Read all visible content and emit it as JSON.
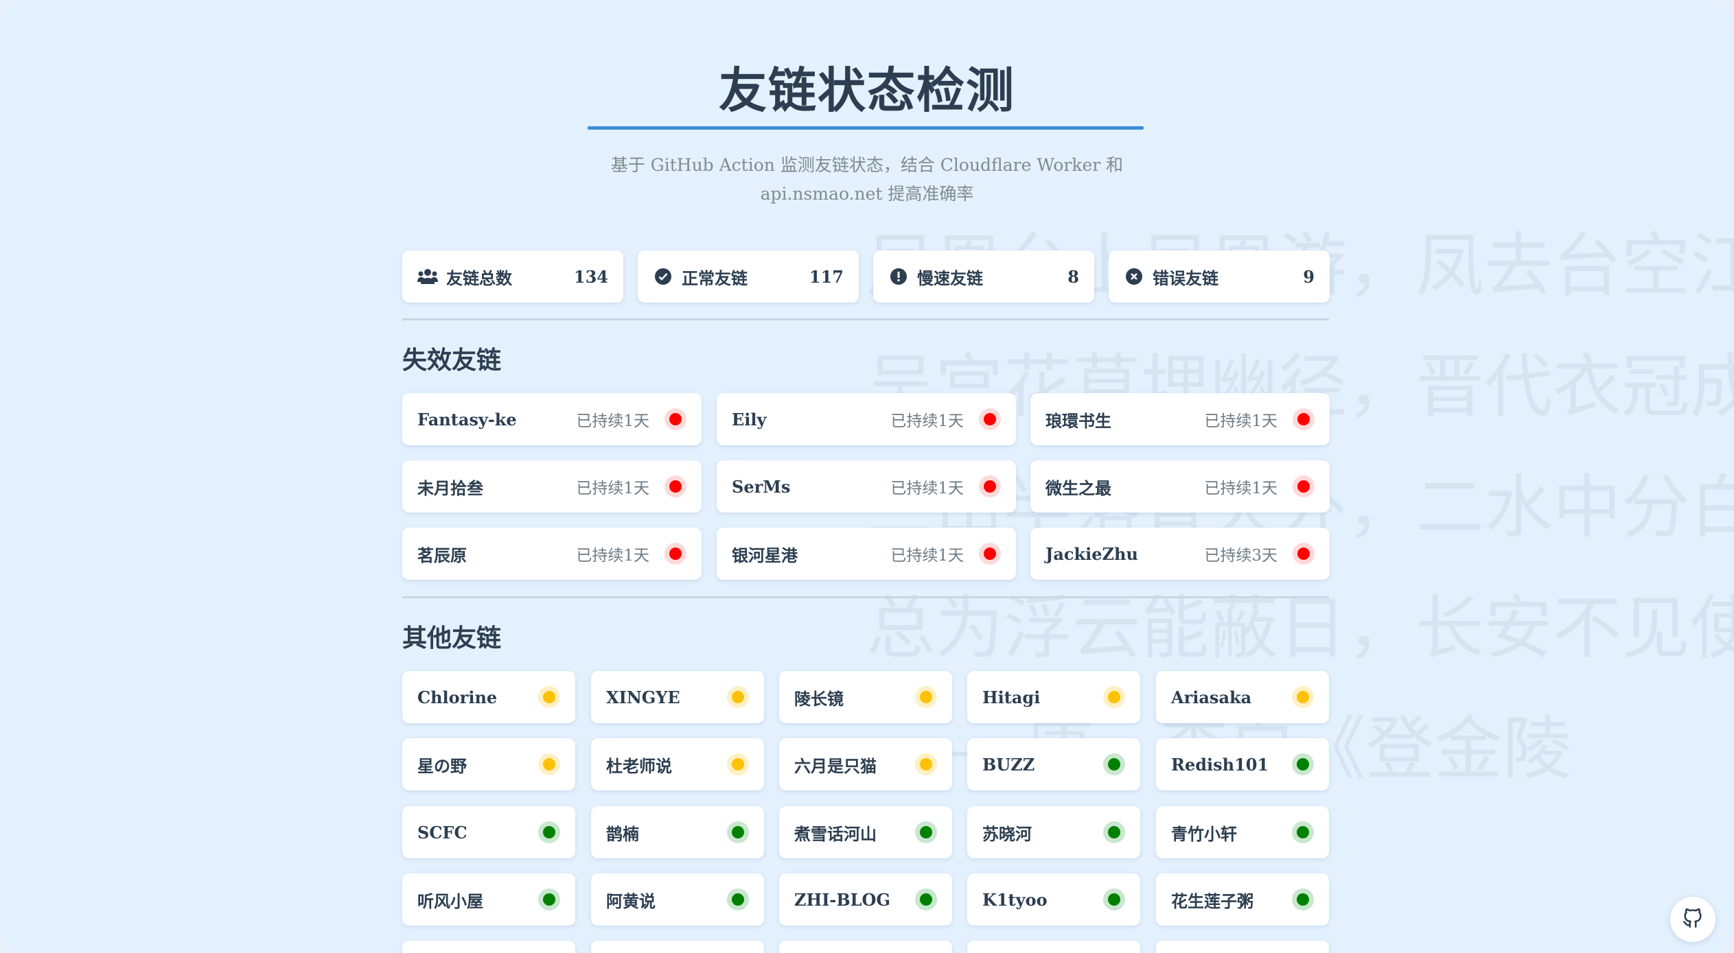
{
  "title": "友链状态检测",
  "subtitle_line1": "基于 GitHub Action 监测友链状态，结合 Cloudflare Worker 和",
  "subtitle_line2": "api.nsmao.net 提高准确率",
  "background_poem": [
    "凤凰台上凤凰游，凤去台空江",
    "吴宫花草埋幽径，晋代衣冠成",
    "三山半落青天外，二水中分白",
    "总为浮云能蔽日，长安不见使",
    "—— 唐 · 李白《登金陵"
  ],
  "stats": [
    {
      "label": "友链总数",
      "value": "134",
      "icon": "users-icon"
    },
    {
      "label": "正常友链",
      "value": "117",
      "icon": "check-circle-icon"
    },
    {
      "label": "慢速友链",
      "value": "8",
      "icon": "exclamation-circle-icon"
    },
    {
      "label": "错误友链",
      "value": "9",
      "icon": "x-circle-icon"
    }
  ],
  "failed_section": {
    "title": "失效友链",
    "items": [
      {
        "name": "Fantasy-ke",
        "duration": "已持续1天"
      },
      {
        "name": "Eily",
        "duration": "已持续1天"
      },
      {
        "name": "琅環书生",
        "duration": "已持续1天"
      },
      {
        "name": "未月拾叁",
        "duration": "已持续1天"
      },
      {
        "name": "SerMs",
        "duration": "已持续1天"
      },
      {
        "name": "微生之最",
        "duration": "已持续1天"
      },
      {
        "name": "茗辰原",
        "duration": "已持续1天"
      },
      {
        "name": "银河星港",
        "duration": "已持续1天"
      },
      {
        "name": "JackieZhu",
        "duration": "已持续3天"
      }
    ]
  },
  "other_section": {
    "title": "其他友链",
    "items": [
      {
        "name": "Chlorine",
        "status": "slow"
      },
      {
        "name": "XINGYE",
        "status": "slow"
      },
      {
        "name": "陵长镜",
        "status": "slow"
      },
      {
        "name": "Hitagi",
        "status": "slow"
      },
      {
        "name": "Ariasaka",
        "status": "slow"
      },
      {
        "name": "星の野",
        "status": "slow"
      },
      {
        "name": "杜老师说",
        "status": "slow"
      },
      {
        "name": "六月是只猫",
        "status": "slow"
      },
      {
        "name": "BUZZ",
        "status": "ok"
      },
      {
        "name": "Redish101",
        "status": "ok"
      },
      {
        "name": "SCFC",
        "status": "ok"
      },
      {
        "name": "鹊楠",
        "status": "ok"
      },
      {
        "name": "煮雪话河山",
        "status": "ok"
      },
      {
        "name": "苏晓河",
        "status": "ok"
      },
      {
        "name": "青竹小轩",
        "status": "ok"
      },
      {
        "name": "听风小屋",
        "status": "ok"
      },
      {
        "name": "阿黄说",
        "status": "ok"
      },
      {
        "name": "ZHI-BLOG",
        "status": "ok"
      },
      {
        "name": "K1tyoo",
        "status": "ok"
      },
      {
        "name": "花生莲子粥",
        "status": "ok"
      }
    ]
  },
  "colors": {
    "error": "#ff0000",
    "slow": "#ffc107",
    "ok": "#008000",
    "accent": "#3a8fd9",
    "text": "#2c3e50"
  },
  "github_icon": "github-icon"
}
